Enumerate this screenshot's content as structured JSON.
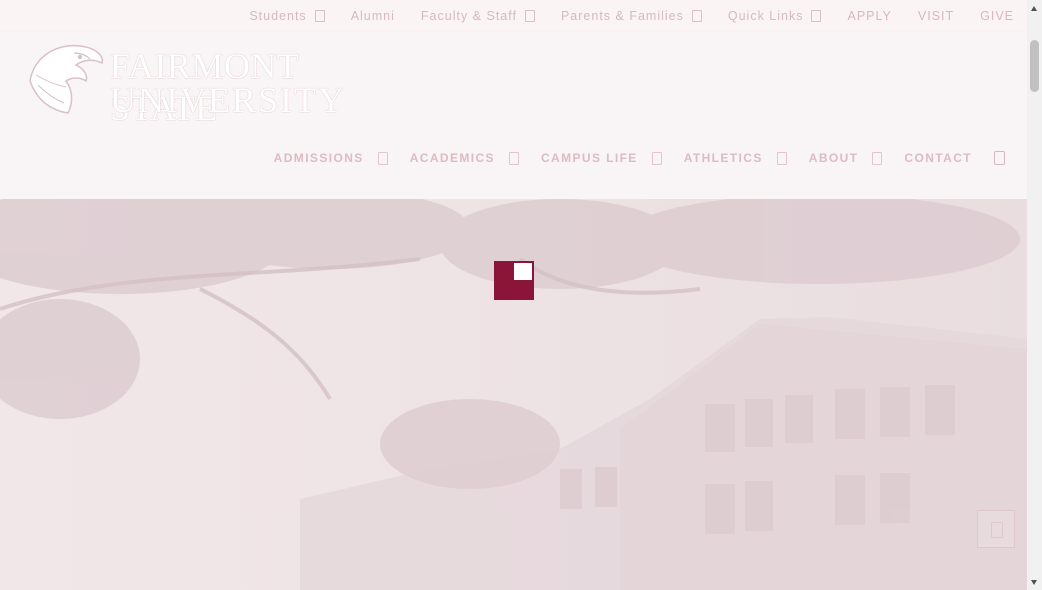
{
  "site": {
    "logo": {
      "line1": "FAIRMONT STATE",
      "line2": "UNIVERSITY",
      "icon": "falcon-head-icon"
    }
  },
  "utility_nav": [
    {
      "label": "Students",
      "has_dropdown": true
    },
    {
      "label": "Alumni",
      "has_dropdown": false
    },
    {
      "label": "Faculty & Staff",
      "has_dropdown": true
    },
    {
      "label": "Parents & Families",
      "has_dropdown": true
    },
    {
      "label": "Quick Links",
      "has_dropdown": true
    },
    {
      "label": "APPLY",
      "has_dropdown": false
    },
    {
      "label": "VISIT",
      "has_dropdown": false
    },
    {
      "label": "GIVE",
      "has_dropdown": false
    }
  ],
  "main_nav": [
    {
      "label": "ADMISSIONS",
      "has_dropdown": true
    },
    {
      "label": "ACADEMICS",
      "has_dropdown": true
    },
    {
      "label": "CAMPUS LIFE",
      "has_dropdown": true
    },
    {
      "label": "ATHLETICS",
      "has_dropdown": true
    },
    {
      "label": "ABOUT",
      "has_dropdown": true
    },
    {
      "label": "CONTACT",
      "has_dropdown": false
    }
  ],
  "icons": {
    "search": "search-icon",
    "back_to_top": "arrow-up-icon",
    "loader": "loading-spinner-icon"
  },
  "colors": {
    "brand_maroon": "#8a1538",
    "overlay": "#f6eff0",
    "nav_text": "#d9b7bf"
  }
}
